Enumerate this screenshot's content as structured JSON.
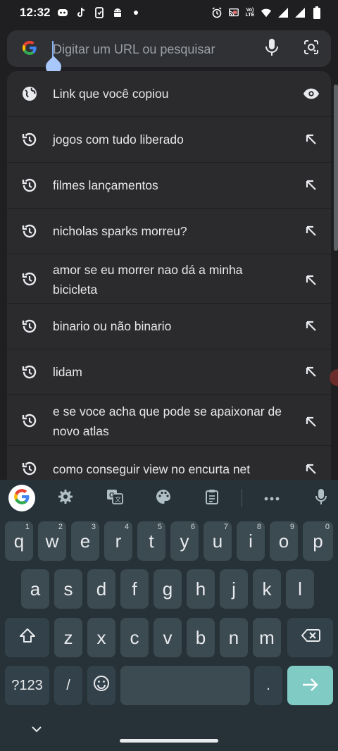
{
  "status_bar": {
    "time": "12:32",
    "network_label": "Vo) LTE"
  },
  "omnibox": {
    "placeholder": "Digitar um URL ou pesquisar",
    "value": ""
  },
  "suggestions": [
    {
      "text": "Link que você copiou",
      "icon": "globe-icon",
      "action": "eye-icon"
    },
    {
      "text": "jogos com tudo liberado",
      "icon": "history-icon",
      "action": "arrow-up-left-icon"
    },
    {
      "text": "filmes lançamentos",
      "icon": "history-icon",
      "action": "arrow-up-left-icon"
    },
    {
      "text": "nicholas sparks morreu?",
      "icon": "history-icon",
      "action": "arrow-up-left-icon"
    },
    {
      "text": "amor se eu morrer nao dá a minha bicicleta",
      "icon": "history-icon",
      "action": "arrow-up-left-icon"
    },
    {
      "text": "binario ou não binario",
      "icon": "history-icon",
      "action": "arrow-up-left-icon"
    },
    {
      "text": "lidam",
      "icon": "history-icon",
      "action": "arrow-up-left-icon"
    },
    {
      "text": "e se voce acha que pode se apaixonar de novo atlas",
      "icon": "history-icon",
      "action": "arrow-up-left-icon"
    },
    {
      "text": "como conseguir view no encurta net",
      "icon": "history-icon",
      "action": "arrow-up-left-icon"
    }
  ],
  "keyboard": {
    "row1": [
      {
        "key": "q",
        "hint": "1"
      },
      {
        "key": "w",
        "hint": "2"
      },
      {
        "key": "e",
        "hint": "3"
      },
      {
        "key": "r",
        "hint": "4"
      },
      {
        "key": "t",
        "hint": "5"
      },
      {
        "key": "y",
        "hint": "6"
      },
      {
        "key": "u",
        "hint": "7"
      },
      {
        "key": "i",
        "hint": "8"
      },
      {
        "key": "o",
        "hint": "9"
      },
      {
        "key": "p",
        "hint": "0"
      }
    ],
    "row2": [
      "a",
      "s",
      "d",
      "f",
      "g",
      "h",
      "j",
      "k",
      "l"
    ],
    "row3": [
      "z",
      "x",
      "c",
      "v",
      "b",
      "n",
      "m"
    ],
    "symbols_label": "?123",
    "slash": "/",
    "period": "."
  },
  "colors": {
    "accent": "#8ab4f8",
    "enter_key": "#80cbc4",
    "keyboard_bg": "#263238"
  }
}
